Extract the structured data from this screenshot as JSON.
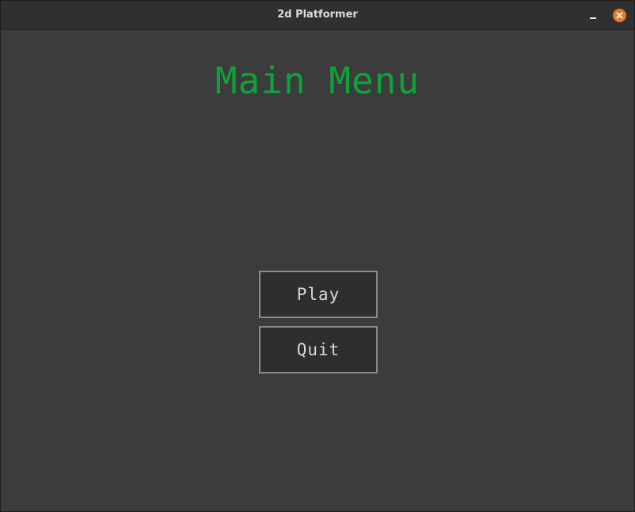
{
  "window": {
    "title": "2d Platformer",
    "controls": {
      "minimize_icon": "minimize-icon",
      "close_icon": "close-icon",
      "close_color": "#e8762b"
    }
  },
  "menu": {
    "heading": "Main Menu",
    "heading_color": "#0ea33a",
    "buttons": {
      "play": "Play",
      "quit": "Quit"
    }
  }
}
